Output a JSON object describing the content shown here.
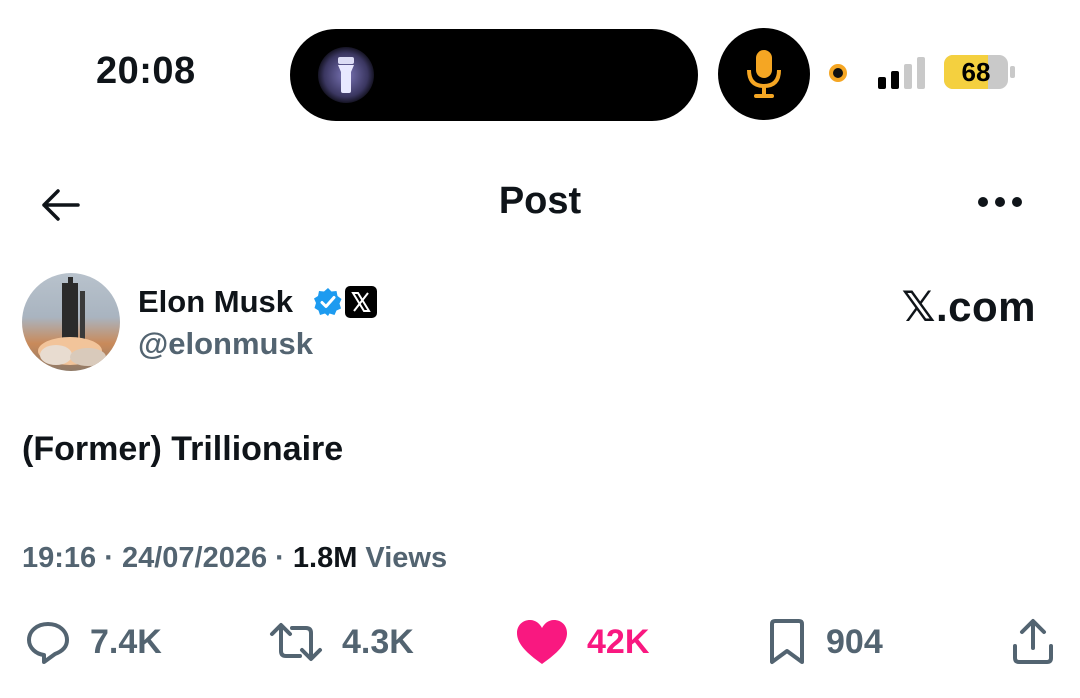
{
  "status_bar": {
    "time": "20:08",
    "battery_level": "68",
    "battery_fraction": 0.68,
    "colors": {
      "mic": "#f5a623",
      "battery": "#f4d03f"
    }
  },
  "header": {
    "title": "Post",
    "back_icon": "arrow-left-icon",
    "more_icon": "more-horizontal-icon"
  },
  "author": {
    "name": "Elon Musk",
    "handle": "@elonmusk",
    "affiliation": "𝕏.com"
  },
  "post": {
    "text": "(Former) Trillionaire",
    "time": "19:16",
    "separator": " · ",
    "date": "24/07/2026",
    "views_count": "1.8M",
    "views_label": " Views"
  },
  "actions": {
    "replies": "7.4K",
    "reposts": "4.3K",
    "likes": "42K",
    "bookmarks": "904",
    "like_color": "#f91880"
  }
}
